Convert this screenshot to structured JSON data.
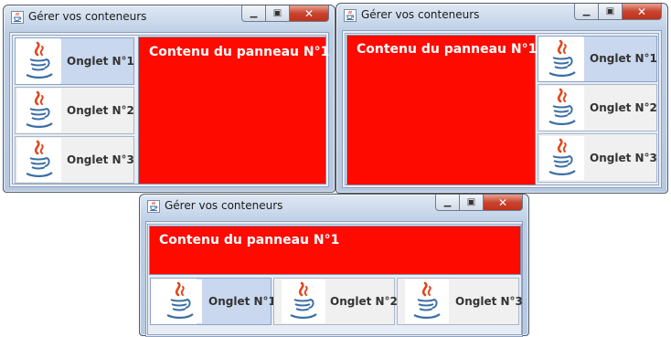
{
  "windows": [
    {
      "title": "Gérer vos conteneurs",
      "panel_text": "Contenu du panneau N°1",
      "tab_placement": "left",
      "tabs": [
        {
          "label": "Onglet N°1",
          "selected": true,
          "icon": "java-icon"
        },
        {
          "label": "Onglet N°2",
          "selected": false,
          "icon": "java-icon"
        },
        {
          "label": "Onglet N°3",
          "selected": false,
          "icon": "java-icon"
        }
      ]
    },
    {
      "title": "Gérer vos conteneurs",
      "panel_text": "Contenu du panneau N°1",
      "tab_placement": "right",
      "tabs": [
        {
          "label": "Onglet N°1",
          "selected": true,
          "icon": "java-icon"
        },
        {
          "label": "Onglet N°2",
          "selected": false,
          "icon": "java-icon"
        },
        {
          "label": "Onglet N°3",
          "selected": false,
          "icon": "java-icon"
        }
      ]
    },
    {
      "title": "Gérer vos conteneurs",
      "panel_text": "Contenu du panneau N°1",
      "tab_placement": "bottom",
      "tabs": [
        {
          "label": "Onglet N°1",
          "selected": true,
          "icon": "java-icon"
        },
        {
          "label": "Onglet N°2",
          "selected": false,
          "icon": "java-icon"
        },
        {
          "label": "Onglet N°3",
          "selected": false,
          "icon": "java-icon"
        }
      ]
    }
  ],
  "window_controls": {
    "minimize": "minimize-icon",
    "maximize": "maximize-icon",
    "close": "close-icon"
  },
  "colors": {
    "panel": "#ff0a00",
    "tab_selected": "#c9d8ee",
    "tab_normal": "#f0f0f0"
  }
}
